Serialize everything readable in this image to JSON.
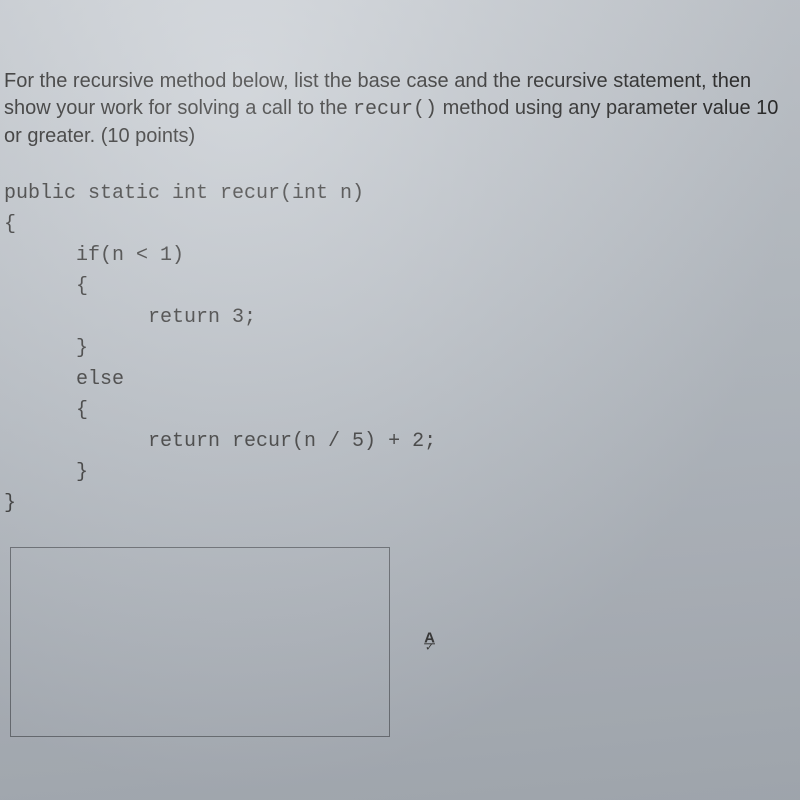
{
  "question": {
    "pre": "For the recursive method below, list the base case and the recursive statement, then show your work for solving a call to the ",
    "mono": "recur()",
    "post": " method using any parameter value 10 or greater. (10 points)"
  },
  "code": {
    "line1": "public static int recur(int n)",
    "line2": "{",
    "line3": "      if(n < 1)",
    "line4": "      {",
    "line5": "            return 3;",
    "line6": "      }",
    "line7": "      else",
    "line8": "      {",
    "line9": "            return recur(n / 5) + 2;",
    "line10": "      }",
    "line11": "}"
  },
  "badge": {
    "letter": "A",
    "check": "✓"
  }
}
